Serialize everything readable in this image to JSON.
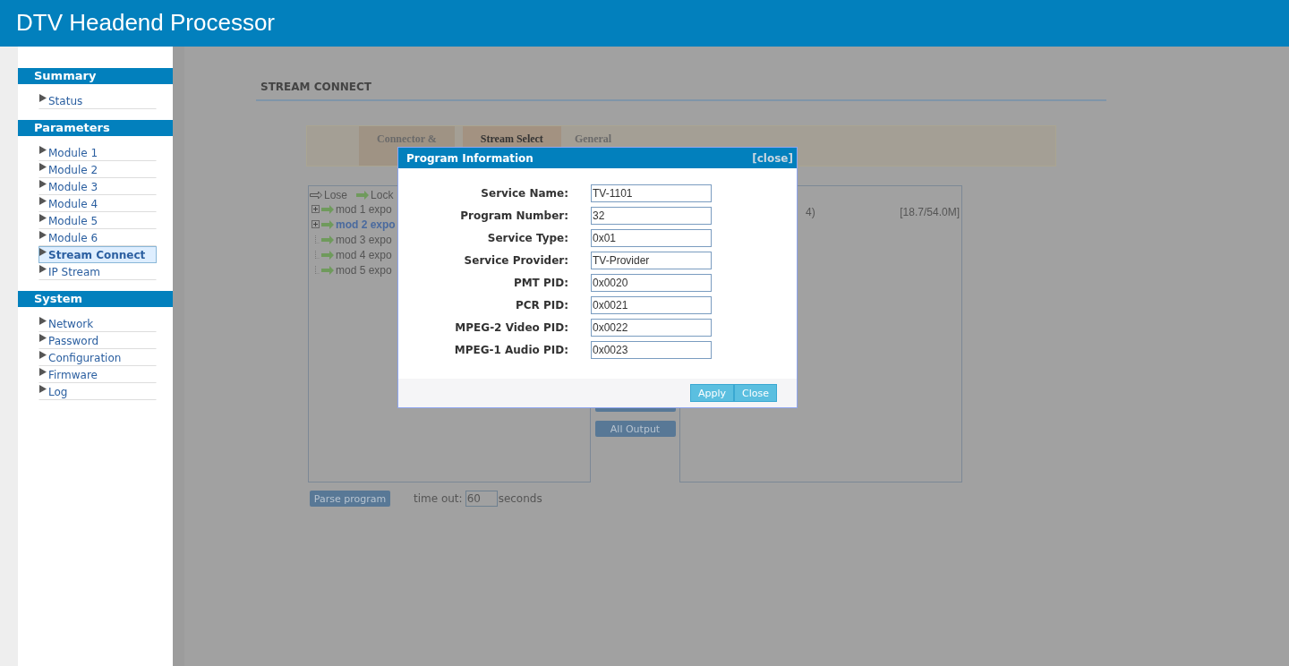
{
  "header": {
    "title": "DTV Headend Processor"
  },
  "sidebar": {
    "sections": [
      {
        "title": "Summary",
        "items": [
          {
            "label": "Status",
            "selected": false
          }
        ]
      },
      {
        "title": "Parameters",
        "items": [
          {
            "label": "Module 1",
            "selected": false
          },
          {
            "label": "Module 2",
            "selected": false
          },
          {
            "label": "Module 3",
            "selected": false
          },
          {
            "label": "Module 4",
            "selected": false
          },
          {
            "label": "Module 5",
            "selected": false
          },
          {
            "label": "Module 6",
            "selected": false
          },
          {
            "label": "Stream Connect",
            "selected": true
          },
          {
            "label": "IP Stream",
            "selected": false
          }
        ]
      },
      {
        "title": "System",
        "items": [
          {
            "label": "Network",
            "selected": false
          },
          {
            "label": "Password",
            "selected": false
          },
          {
            "label": "Configuration",
            "selected": false
          },
          {
            "label": "Firmware",
            "selected": false
          },
          {
            "label": "Log",
            "selected": false
          }
        ]
      }
    ]
  },
  "page": {
    "title": "STREAM CONNECT",
    "tabs": [
      {
        "label": "Connector &",
        "selected": false
      },
      {
        "label": "Stream Select",
        "selected": true
      },
      {
        "label": "General",
        "selected": false
      }
    ],
    "legend": [
      {
        "kind": "lose",
        "label": "Lose"
      },
      {
        "kind": "lock",
        "label": "Lock"
      }
    ],
    "tree": [
      {
        "label": "mod 1 expo",
        "expandable": true,
        "selected": false
      },
      {
        "label": "mod 2 expo",
        "expandable": true,
        "selected": true
      },
      {
        "label": "mod 3 expo",
        "expandable": false,
        "selected": false
      },
      {
        "label": "mod 4 expo",
        "expandable": false,
        "selected": false
      },
      {
        "label": "mod 5 expo",
        "expandable": false,
        "selected": false
      }
    ],
    "output_rows": [
      {
        "column_1": "4)",
        "column_2": "[18.7/54.0M]"
      }
    ],
    "middle_buttons": [
      "All Output"
    ],
    "parse_button": "Parse program",
    "timeout_label": "time out:",
    "timeout_value": "60",
    "timeout_unit": "seconds"
  },
  "dialog": {
    "title": "Program Information",
    "close_link": "[close]",
    "fields": [
      {
        "label": "Service Name:",
        "value": "TV-1101"
      },
      {
        "label": "Program Number:",
        "value": "32"
      },
      {
        "label": "Service Type:",
        "value": "0x01"
      },
      {
        "label": "Service Provider:",
        "value": "TV-Provider"
      },
      {
        "label": "PMT PID:",
        "value": "0x0020"
      },
      {
        "label": "PCR PID:",
        "value": "0x0021"
      },
      {
        "label": "MPEG-2 Video PID:",
        "value": "0x0022"
      },
      {
        "label": "MPEG-1 Audio PID:",
        "value": "0x0023"
      }
    ],
    "buttons": [
      "Apply",
      "Close"
    ]
  }
}
